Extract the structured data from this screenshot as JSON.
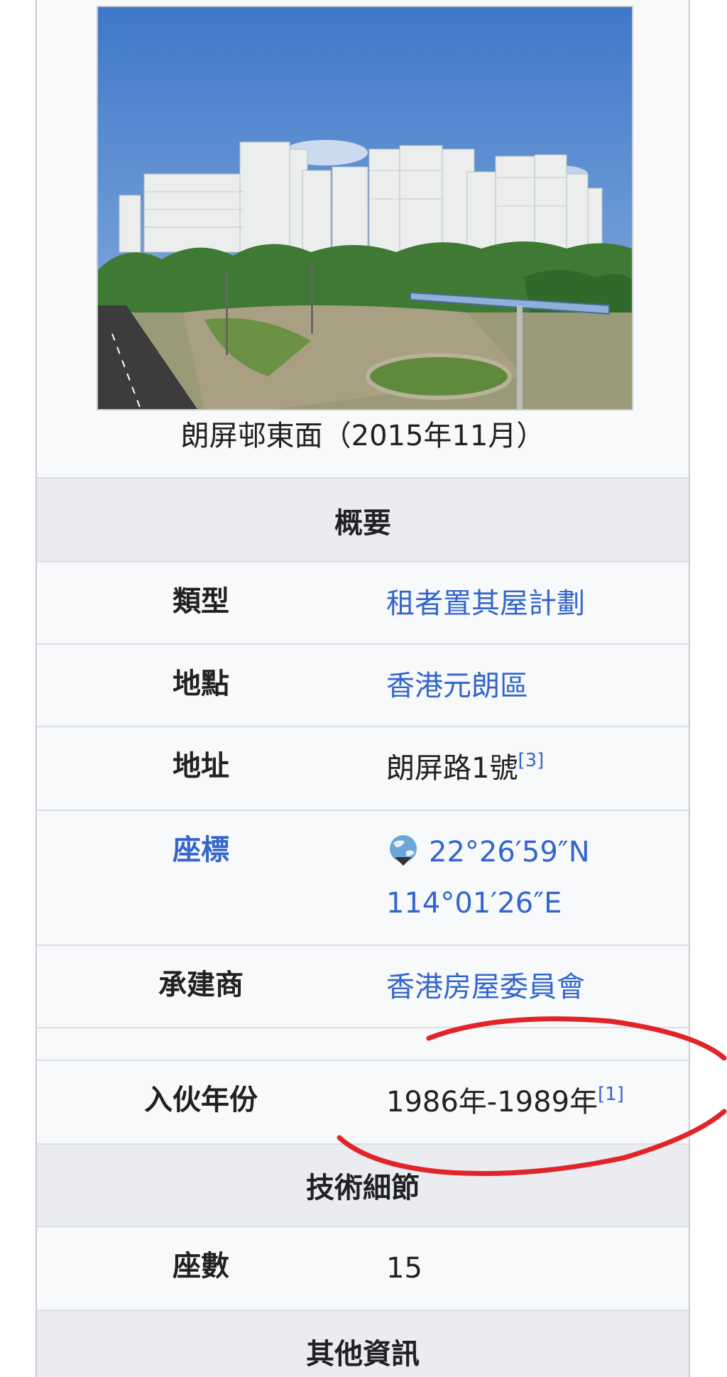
{
  "photo": {
    "caption": "朗屏邨東面（2015年11月）"
  },
  "sections": {
    "overview": "概要",
    "technical": "技術細節",
    "other": "其他資訊"
  },
  "rows": {
    "type": {
      "label": "類型",
      "value": "租者置其屋計劃"
    },
    "location": {
      "label": "地點",
      "value": "香港元朗區"
    },
    "address": {
      "label": "地址",
      "value": "朗屏路1號",
      "ref": "[3]"
    },
    "coords": {
      "label": "座標",
      "value_line1": "22°26′59″N",
      "value_line2": "114°01′26″E"
    },
    "contractor": {
      "label": "承建商",
      "value": "香港房屋委員會"
    },
    "intake": {
      "label": "入伙年份",
      "value": "1986年-1989年",
      "ref": "[1]"
    },
    "blocks": {
      "label": "座數",
      "value": "15"
    }
  },
  "icons": {
    "coords": "globe-icon"
  },
  "colors": {
    "link": "#3366cc",
    "header_bg": "#eaecf0",
    "annotation": "#e0242a"
  }
}
